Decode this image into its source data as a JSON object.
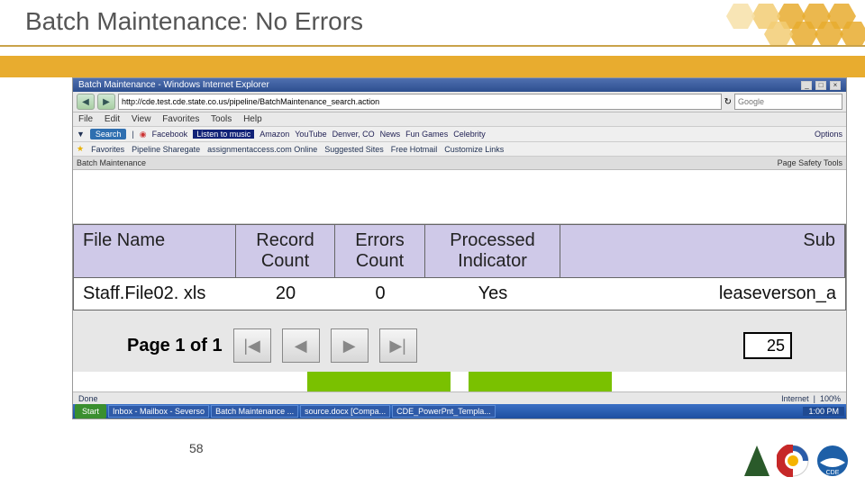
{
  "slide": {
    "title": "Batch Maintenance: No Errors",
    "page_number": "58"
  },
  "browser": {
    "window_title": "Batch Maintenance - Windows Internet Explorer",
    "url": "http://cde.test.cde.state.co.us/pipeline/BatchMaintenance_search.action",
    "search_provider": "Google",
    "menus": {
      "file": "File",
      "edit": "Edit",
      "view": "View",
      "favorites": "Favorites",
      "tools": "Tools",
      "help": "Help"
    },
    "toolbar": {
      "search_label": "Search",
      "items": [
        "Facebook",
        "Listen to music",
        "Amazon",
        "YouTube",
        "Denver, CO",
        "News",
        "Fun Games",
        "Celebrity",
        "Options"
      ]
    },
    "favbar": {
      "star": "Favorites",
      "items": [
        "Pipeline Sharegate",
        "assignmentaccess.com Online",
        "Suggested Sites",
        "Free Hotmail",
        "Customize Links"
      ]
    },
    "tab": "Batch Maintenance",
    "tabtools": "Page  Safety  Tools",
    "status": {
      "left": "Done",
      "right": "Internet",
      "zoom": "100%"
    }
  },
  "table": {
    "headers": {
      "file_name": "File Name",
      "record_count": "Record\nCount",
      "errors_count": "Errors\nCount",
      "processed": "Processed\nIndicator",
      "submitter": "Sub"
    },
    "row": {
      "file_name": "Staff.File02. xls",
      "record_count": "20",
      "errors_count": "0",
      "processed": "Yes",
      "submitter": "leaseverson_a"
    }
  },
  "pager": {
    "label": "Page 1 of 1",
    "first": "|◀",
    "prev": "◀",
    "next": "▶",
    "last": "▶|",
    "page_size": "25"
  },
  "taskbar": {
    "start": "Start",
    "items": [
      "Inbox - Mailbox - Severso",
      "Batch Maintenance ...",
      "source.docx [Compa...",
      "CDE_PowerPnt_Templa..."
    ],
    "clock": "1:00 PM"
  }
}
